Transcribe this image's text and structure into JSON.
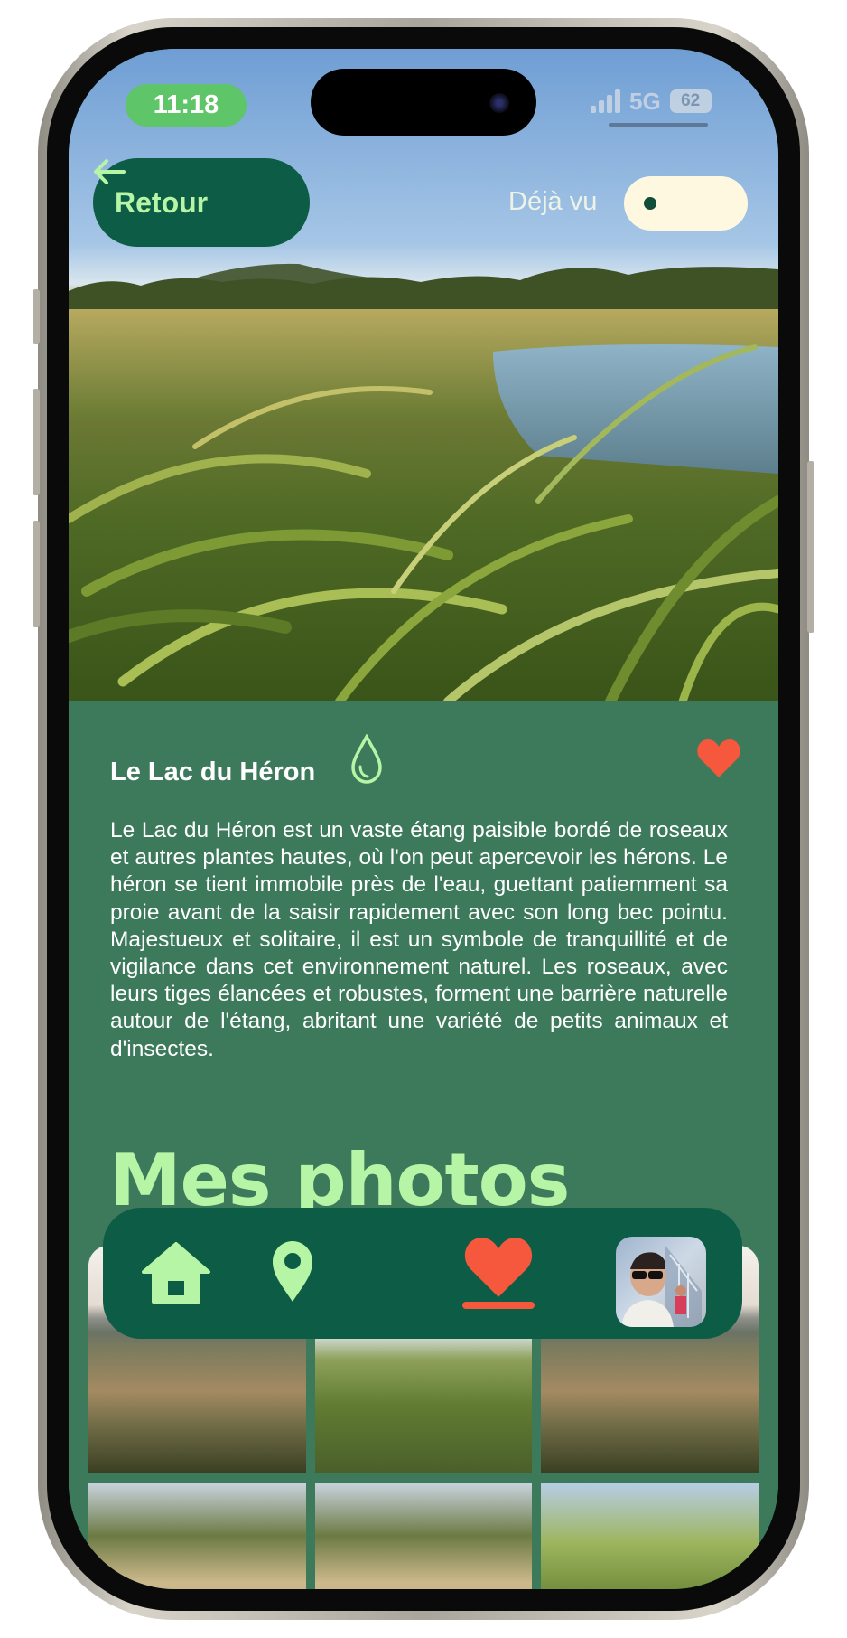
{
  "status_bar": {
    "time": "11:18",
    "network": "5G",
    "battery": "62"
  },
  "header": {
    "back_label": "Retour",
    "seen_label": "Déjà vu",
    "seen_toggle_on": false
  },
  "place": {
    "title": "Le Lac du Héron",
    "description": "Le Lac du Héron est un vaste étang paisible bordé de roseaux et autres plantes hautes, où l'on peut apercevoir les hérons. Le héron se tient immobile près de l'eau, guettant patiemment sa proie avant de la saisir rapidement avec son long bec pointu. Majestueux et solitaire, il est un symbole de tranquillité et de vigilance dans cet environnement naturel. Les roseaux, avec leurs tiges élancées et robustes, forment une barrière naturelle autour de l'étang, abritant une variété de petits animaux et d'insectes.",
    "type_icon": "water-drop-icon",
    "favorite_icon": "heart-icon"
  },
  "photos": {
    "title": "Mes photos"
  },
  "nav": {
    "items": [
      "home-icon",
      "map-pin-icon",
      "heart-icon",
      "profile-avatar"
    ],
    "active_index": 2
  },
  "colors": {
    "content_bg": "#3d7a5c",
    "nav_bg": "#0d5c46",
    "accent_light_green": "#b6f5a5",
    "heart_red": "#f5583c",
    "time_pill": "#5ec568"
  }
}
